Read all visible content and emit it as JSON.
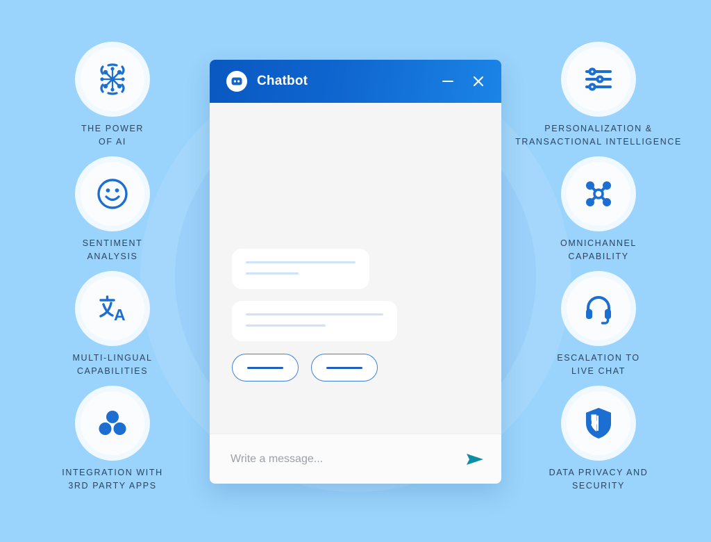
{
  "theme": {
    "background": "#9ad3fb",
    "header_gradient_from": "#0a58c2",
    "header_gradient_to": "#1b84e6",
    "icon_blue": "#1c6fd0",
    "label_color": "#2d4460",
    "bubble_line_color": "#cfe2fb",
    "pill_border": "#3b82d8",
    "send_icon_color": "#0b8fa8"
  },
  "chat": {
    "title": "Chatbot",
    "avatar_icon": "bot-face-icon",
    "minimize_icon": "minimize-icon",
    "close_icon": "close-icon",
    "bubbles": [
      {
        "id": "bubble-1",
        "lines": [
          100,
          48
        ]
      },
      {
        "id": "bubble-2",
        "lines": [
          100,
          58
        ]
      }
    ],
    "quick_replies": [
      {
        "id": "quick-reply-1"
      },
      {
        "id": "quick-reply-2"
      }
    ],
    "input": {
      "placeholder": "Write a message...",
      "value": "",
      "send_icon": "send-arrow-icon"
    }
  },
  "features_left": [
    {
      "id": "the-power-of-ai",
      "icon": "ai-brain-network-icon",
      "label": "THE POWER\nOF AI"
    },
    {
      "id": "sentiment-analysis",
      "icon": "smiley-face-icon",
      "label": "SENTIMENT\nANALYSIS"
    },
    {
      "id": "multi-lingual",
      "icon": "translate-icon",
      "label": "MULTI-LINGUAL\nCAPABILITIES"
    },
    {
      "id": "integration-3rd-party",
      "icon": "three-circles-icon",
      "label": "INTEGRATION WITH\n3RD PARTY APPS"
    }
  ],
  "features_right": [
    {
      "id": "personalization",
      "icon": "sliders-icon",
      "label": "PERSONALIZATION &\nTRANSACTIONAL INTELLIGENCE"
    },
    {
      "id": "omnichannel",
      "icon": "network-nodes-icon",
      "label": "OMNICHANNEL\nCAPABILITY"
    },
    {
      "id": "escalation-live-chat",
      "icon": "headset-icon",
      "label": "ESCALATION TO\nLIVE CHAT"
    },
    {
      "id": "data-privacy-security",
      "icon": "shield-icon",
      "label": "DATA PRIVACY AND\nSECURITY"
    }
  ]
}
